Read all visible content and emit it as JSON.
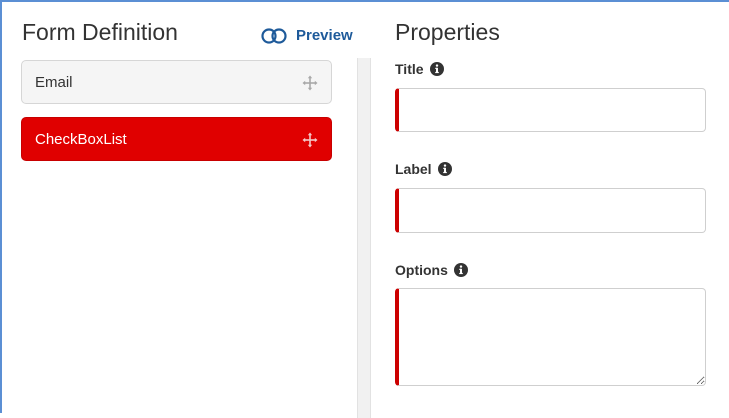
{
  "form_definition": {
    "title": "Form Definition",
    "preview_label": "Preview",
    "preview_icon": "toggle-icon",
    "fields": [
      {
        "label": "Email",
        "icon": "move-icon",
        "selected": false
      },
      {
        "label": "CheckBoxList",
        "icon": "move-icon",
        "selected": true
      }
    ]
  },
  "properties": {
    "title": "Properties",
    "title_field": {
      "label": "Title",
      "icon": "info-icon",
      "value": ""
    },
    "label_field": {
      "label": "Label",
      "icon": "info-icon",
      "value": ""
    },
    "options_field": {
      "label": "Options",
      "icon": "info-icon",
      "value": ""
    }
  },
  "colors": {
    "accent": "#1e5a9a",
    "selected": "#e00000",
    "required_border": "#cc0000",
    "frame": "#5b8fd4"
  }
}
